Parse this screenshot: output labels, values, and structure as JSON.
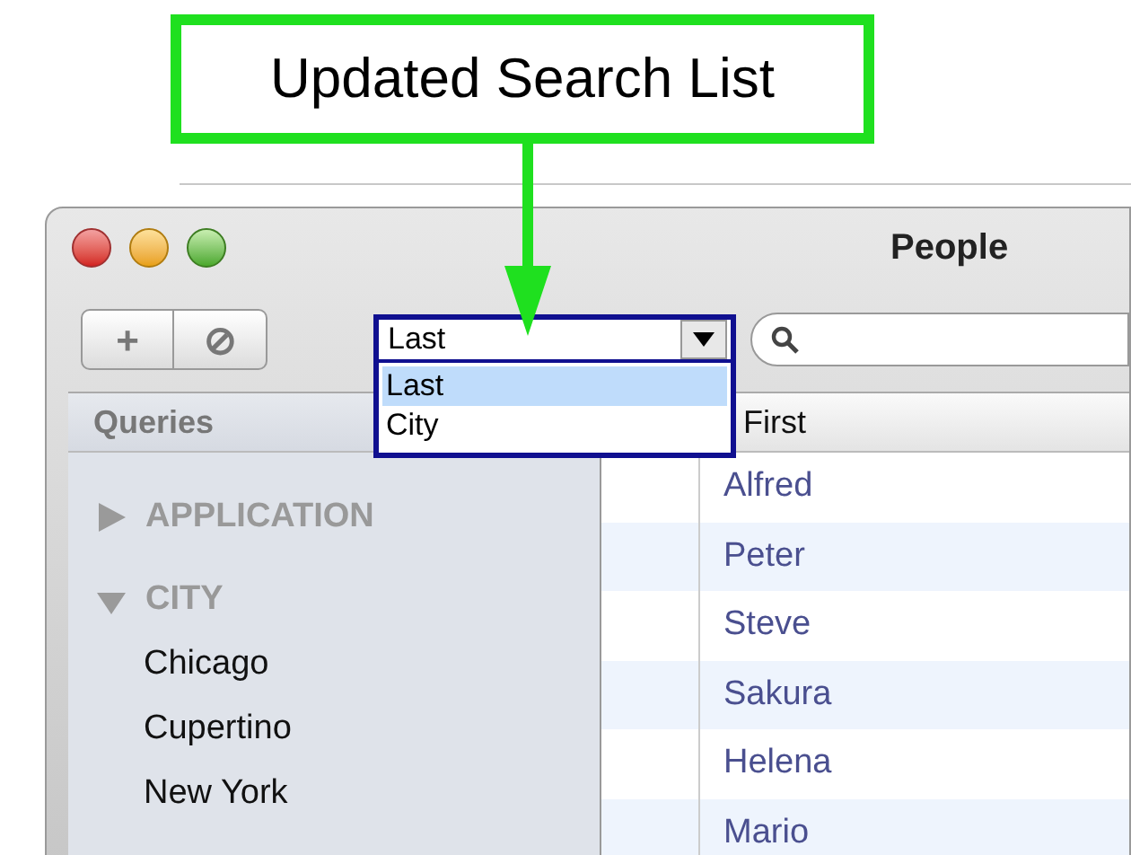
{
  "callout": {
    "text": "Updated Search List"
  },
  "window": {
    "title": "People"
  },
  "toolbar": {
    "buttons": [
      "+",
      "⊘"
    ]
  },
  "dropdown": {
    "value": "Last",
    "expanded": true,
    "options": [
      {
        "label": "Last",
        "selected": true
      },
      {
        "label": "City",
        "selected": false
      }
    ]
  },
  "sidebar": {
    "header": "Queries",
    "groups": [
      {
        "label": "APPLICATION",
        "expanded": false
      },
      {
        "label": "CITY",
        "expanded": true,
        "children": [
          {
            "label": "Chicago"
          },
          {
            "label": "Cupertino"
          },
          {
            "label": "New York"
          }
        ]
      }
    ]
  },
  "table": {
    "columns": [
      "First"
    ],
    "rows": [
      "Alfred",
      "Peter",
      "Steve",
      "Sakura",
      "Helena",
      "Mario"
    ]
  }
}
